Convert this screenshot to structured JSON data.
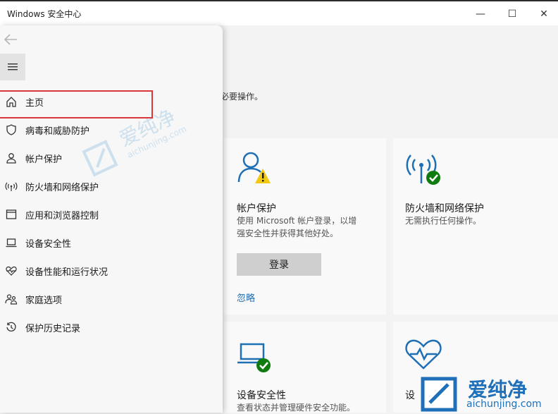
{
  "window": {
    "title": "Windows 安全中心",
    "minimize_glyph": "—",
    "maximize_glyph": "☐",
    "close_glyph": "✕"
  },
  "main": {
    "partial_note": "必要操作。",
    "cards": [
      {
        "title": "帐户保护",
        "desc_line1": "使用 Microsoft 帐户登录，以增",
        "desc_line2": "强安全性并获得其他好处。",
        "button": "登录",
        "link": "忽略",
        "icon": "person-warning-icon"
      },
      {
        "title": "防火墙和网络保护",
        "desc": "无需执行任何操作。",
        "icon": "wifi-check-icon"
      },
      {
        "title": "设备安全性",
        "desc": "查看状态并管理硬件安全功能。",
        "icon": "laptop-check-icon"
      },
      {
        "title": "设",
        "icon": "heart-pulse-icon"
      }
    ]
  },
  "nav": {
    "items": [
      {
        "label": "主页",
        "icon": "home-icon"
      },
      {
        "label": "病毒和威胁防护",
        "icon": "shield-icon"
      },
      {
        "label": "帐户保护",
        "icon": "person-icon"
      },
      {
        "label": "防火墙和网络保护",
        "icon": "wifi-icon"
      },
      {
        "label": "应用和浏览器控制",
        "icon": "browser-window-icon"
      },
      {
        "label": "设备安全性",
        "icon": "laptop-icon"
      },
      {
        "label": "设备性能和运行状况",
        "icon": "heart-pulse-icon"
      },
      {
        "label": "家庭选项",
        "icon": "family-icon"
      },
      {
        "label": "保护历史记录",
        "icon": "history-icon"
      }
    ]
  },
  "watermark": {
    "text": "爱纯净",
    "url": "aichunjing.com"
  },
  "colors": {
    "accent": "#1f6fb5",
    "highlight": "#d9373c",
    "ok": "#107c10",
    "warn": "#f2c811"
  }
}
